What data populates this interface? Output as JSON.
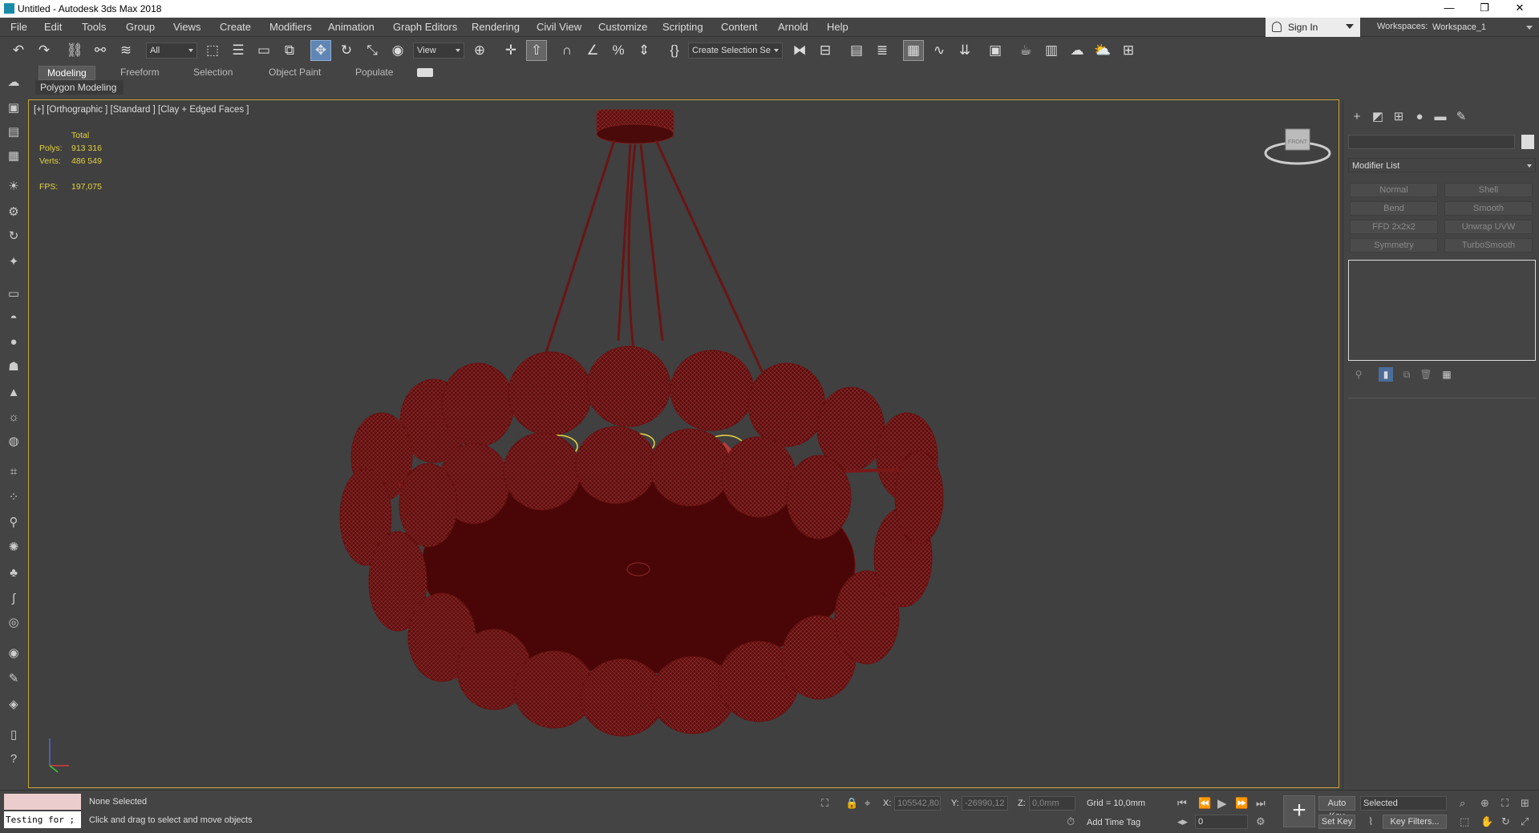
{
  "window": {
    "title": "Untitled - Autodesk 3ds Max 2018"
  },
  "menu": [
    "File",
    "Edit",
    "Tools",
    "Group",
    "Views",
    "Create",
    "Modifiers",
    "Animation",
    "Graph Editors",
    "Rendering",
    "Civil View",
    "Customize",
    "Scripting",
    "Content",
    "Arnold",
    "Help"
  ],
  "account": {
    "sign_in": "Sign In",
    "workspaces_label": "Workspaces:",
    "workspace_value": "Workspace_1"
  },
  "toolbar": {
    "filter_value": "All",
    "coord_system": "View",
    "named_selection": "Create Selection Se"
  },
  "ribbon": {
    "tabs": [
      "Modeling",
      "Freeform",
      "Selection",
      "Object Paint",
      "Populate"
    ],
    "active_tab": "Modeling",
    "panel_label": "Polygon Modeling"
  },
  "viewport": {
    "label": "[+] [Orthographic ] [Standard ] [Clay + Edged Faces ]",
    "stats": {
      "header": "Total",
      "polys_label": "Polys:",
      "polys_value": "913 316",
      "verts_label": "Verts:",
      "verts_value": "486 549",
      "fps_label": "FPS:",
      "fps_value": "197,075"
    },
    "viewcube_label": "FRONT"
  },
  "command_panel": {
    "modifier_list": "Modifier List",
    "modifier_buttons": [
      "Normal",
      "Shell",
      "Bend",
      "Smooth",
      "FFD 2x2x2",
      "Unwrap UVW",
      "Symmetry",
      "TurboSmooth"
    ]
  },
  "status": {
    "listener_text": "Testing for ;",
    "selection": "None Selected",
    "prompt": "Click and drag to select and move objects",
    "x_label": "X:",
    "x_value": "105542,80",
    "y_label": "Y:",
    "y_value": "-26990,12",
    "z_label": "Z:",
    "z_value": "0,0mm",
    "grid": "Grid = 10,0mm",
    "add_time_tag": "Add Time Tag",
    "frame_value": "0",
    "auto_key": "Auto Key",
    "set_key": "Set Key",
    "key_mode": "Selected",
    "key_filters": "Key Filters..."
  },
  "colors": {
    "viewport_border": "#c8a43a",
    "mesh": "#5a0c0c",
    "wire": "#a83a3a",
    "stats_text": "#e5d23f",
    "active_tool": "#5f86b4"
  }
}
